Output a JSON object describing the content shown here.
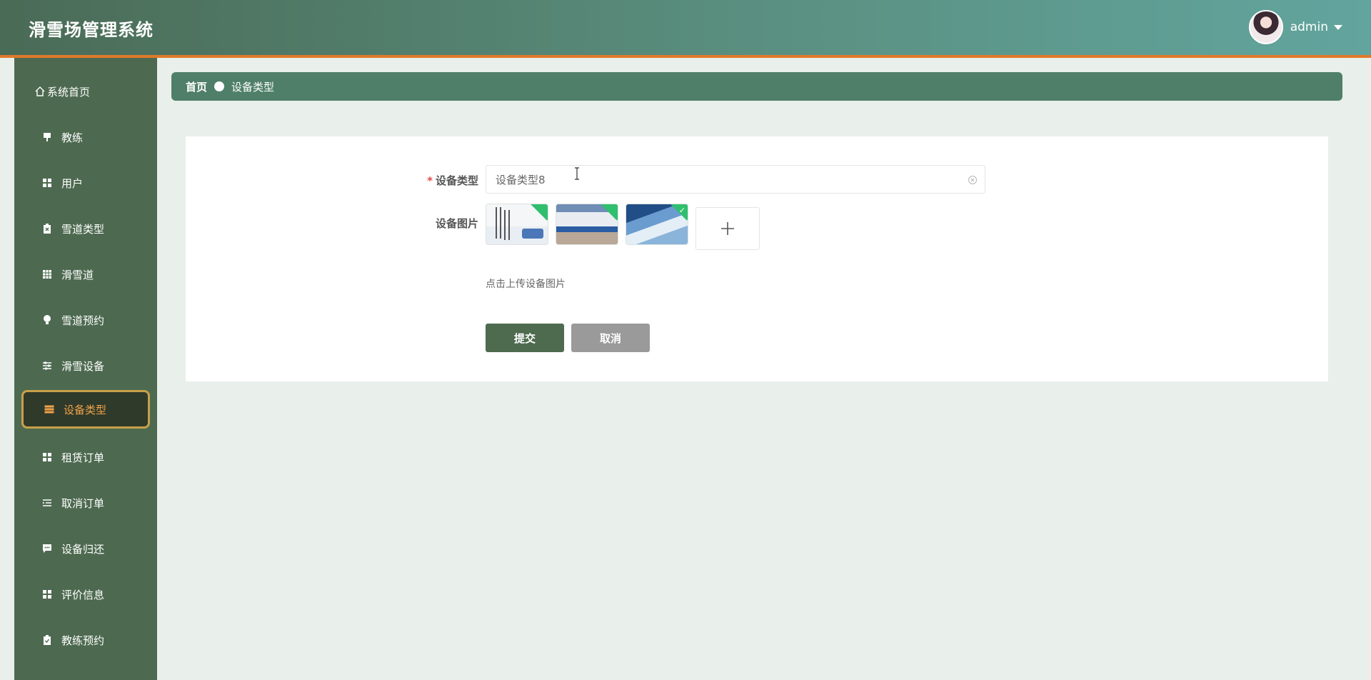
{
  "header": {
    "app_title": "滑雪场管理系统",
    "username": "admin"
  },
  "sidebar": {
    "items": [
      {
        "label": "系统首页",
        "icon": "home-icon"
      },
      {
        "label": "教练",
        "icon": "flag-icon"
      },
      {
        "label": "用户",
        "icon": "grid-icon"
      },
      {
        "label": "雪道类型",
        "icon": "clipboard-icon"
      },
      {
        "label": "滑雪道",
        "icon": "table-icon"
      },
      {
        "label": "雪道预约",
        "icon": "bulb-icon"
      },
      {
        "label": "滑雪设备",
        "icon": "sliders-icon"
      },
      {
        "label": "设备类型",
        "icon": "list-icon",
        "active": true
      },
      {
        "label": "租赁订单",
        "icon": "grid-icon"
      },
      {
        "label": "取消订单",
        "icon": "indent-list-icon"
      },
      {
        "label": "设备归还",
        "icon": "chat-icon"
      },
      {
        "label": "评价信息",
        "icon": "grid-icon"
      },
      {
        "label": "教练预约",
        "icon": "clipboard-check-icon"
      }
    ]
  },
  "breadcrumb": {
    "home": "首页",
    "current": "设备类型"
  },
  "form": {
    "type_label": "设备类型",
    "type_value": "设备类型8",
    "image_label": "设备图片",
    "upload_hint": "点击上传设备图片",
    "submit_label": "提交",
    "cancel_label": "取消"
  },
  "colors": {
    "accent": "#e07a2a",
    "sidebar_bg": "#4d6a50",
    "breadcrumb_bg": "#4f7f68",
    "active_text": "#f0a24a",
    "submit_bg": "#4e6b50",
    "cancel_bg": "#9a9a9a"
  }
}
